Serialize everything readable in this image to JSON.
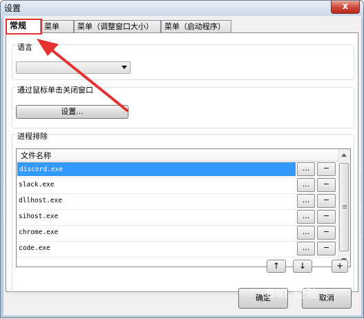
{
  "window": {
    "title": "设置",
    "close_label": "x"
  },
  "tabs": [
    {
      "label": "常规",
      "active": true
    },
    {
      "label": "菜单",
      "active": false
    },
    {
      "label": "菜单（调整窗口大小）",
      "active": false
    },
    {
      "label": "菜单（启动程序）",
      "active": false
    }
  ],
  "language_group": {
    "title": "语言",
    "selected_value": ""
  },
  "close_group": {
    "title": "通过鼠标单击关闭窗口",
    "settings_button": "设置..."
  },
  "exclusion_group": {
    "title": "进程排除",
    "column_header": "文件名称",
    "rows": [
      {
        "name": "discord.exe",
        "selected": true
      },
      {
        "name": "slack.exe",
        "selected": false
      },
      {
        "name": "dllhost.exe",
        "selected": false
      },
      {
        "name": "sihost.exe",
        "selected": false
      },
      {
        "name": "chrome.exe",
        "selected": false
      },
      {
        "name": "code.exe",
        "selected": false
      }
    ],
    "browse_label": "...",
    "remove_label": "−",
    "up_label": "↑",
    "down_label": "↓",
    "add_label": "+"
  },
  "footer": {
    "ok_label": "确定",
    "cancel_label": "取消"
  },
  "watermark": "Bai 经验",
  "colors": {
    "selection": "#3399ff",
    "annotation": "#e5312f"
  }
}
